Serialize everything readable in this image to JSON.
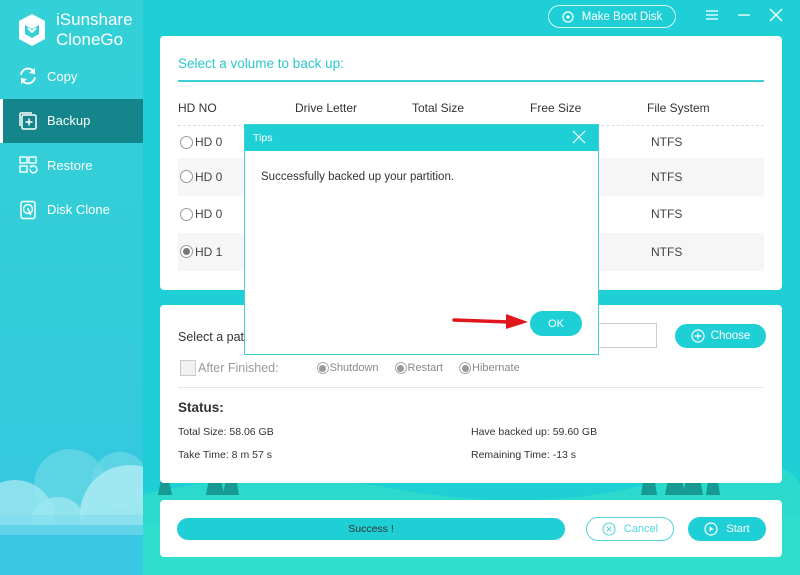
{
  "app": {
    "brand_line1": "iSunshare",
    "brand_line2": "CloneGo",
    "accent_color": "#1fcfd6",
    "active_nav_color": "#14858a"
  },
  "topbar": {
    "make_boot_disk_label": "Make Boot Disk",
    "make_boot_disk_icon": "disc-icon",
    "menu_icon": "menu-icon",
    "minimize_icon": "minimize-icon",
    "close_icon": "close-icon"
  },
  "sidebar": {
    "items": [
      {
        "label": "Copy",
        "icon": "sync-icon",
        "active": false
      },
      {
        "label": "Backup",
        "icon": "backup-plus-icon",
        "active": true
      },
      {
        "label": "Restore",
        "icon": "restore-icon",
        "active": false
      },
      {
        "label": "Disk Clone",
        "icon": "disk-clone-icon",
        "active": false
      }
    ]
  },
  "volume_panel": {
    "title": "Select a volume to back up:",
    "columns": [
      "HD NO",
      "Drive Letter",
      "Total Size",
      "Free Size",
      "File System"
    ],
    "rows": [
      {
        "hd": "HD 0",
        "drive_letter": "",
        "total_size": "",
        "free_size": "",
        "file_system": "NTFS",
        "selected": false
      },
      {
        "hd": "HD 0",
        "drive_letter": "",
        "total_size": "",
        "free_size": "",
        "file_system": "NTFS",
        "selected": false
      },
      {
        "hd": "HD 0",
        "drive_letter": "",
        "total_size": "",
        "free_size": "",
        "file_system": "NTFS",
        "selected": false
      },
      {
        "hd": "HD 1",
        "drive_letter": "",
        "total_size": "",
        "free_size": "",
        "file_system": "NTFS",
        "selected": true
      }
    ]
  },
  "path_panel": {
    "label": "Select a path",
    "path_value": "",
    "choose_label": "Choose",
    "after_finished_label": "After Finished:",
    "after_finished_checked": false,
    "options": [
      "Shutdown",
      "Restart",
      "Hibernate"
    ],
    "status_title": "Status:",
    "total_size": "Total Size: 58.06 GB",
    "take_time": "Take Time: 8 m 57 s",
    "have_backed_up": "Have backed up: 59.60 GB",
    "remaining_time": "Remaining Time: -13 s"
  },
  "bottom": {
    "progress_text": "Success !",
    "progress_fraction": 1.0,
    "cancel_label": "Cancel",
    "start_label": "Start"
  },
  "dialog": {
    "title": "Tips",
    "message": "Successfully backed up your partition.",
    "ok_label": "OK"
  }
}
